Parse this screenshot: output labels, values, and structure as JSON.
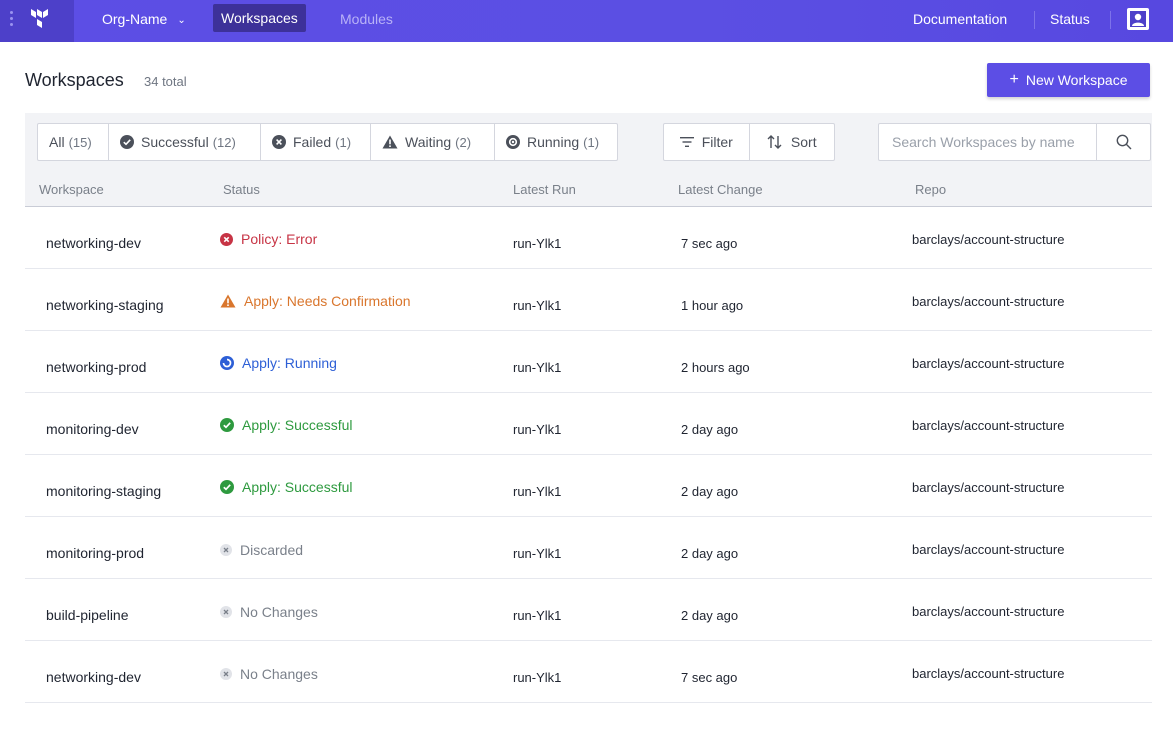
{
  "nav": {
    "org_name": "Org-Name",
    "items": [
      {
        "label": "Workspaces"
      },
      {
        "label": "Modules"
      }
    ],
    "documentation": "Documentation",
    "status": "Status",
    "brand_color": "#5c4ee5"
  },
  "header": {
    "title": "Workspaces",
    "count": "34 total",
    "new_button": "New Workspace"
  },
  "filters": {
    "tabs": [
      {
        "label": "All",
        "count": "(15)",
        "icon": ""
      },
      {
        "label": "Successful",
        "count": "(12)",
        "icon": "check-circle-icon"
      },
      {
        "label": "Failed",
        "count": "(1)",
        "icon": "x-circle-icon"
      },
      {
        "label": "Waiting",
        "count": "(2)",
        "icon": "warning-triangle-icon"
      },
      {
        "label": "Running",
        "count": "(1)",
        "icon": "running-icon"
      }
    ],
    "filter_label": "Filter",
    "sort_label": "Sort",
    "search_placeholder": "Search Workspaces by name"
  },
  "table": {
    "columns": [
      "Workspace",
      "Status",
      "Latest Run",
      "Latest Change",
      "Repo"
    ],
    "rows": [
      {
        "workspace": "networking-dev",
        "status": "Policy: Error",
        "status_kind": "error",
        "run": "run-Ylk1",
        "change": "7 sec ago",
        "repo": "barclays/account-structure"
      },
      {
        "workspace": "networking-staging",
        "status": "Apply: Needs Confirmation",
        "status_kind": "warn",
        "run": "run-Ylk1",
        "change": "1 hour ago",
        "repo": "barclays/account-structure"
      },
      {
        "workspace": "networking-prod",
        "status": "Apply: Running",
        "status_kind": "running",
        "run": "run-Ylk1",
        "change": "2 hours ago",
        "repo": "barclays/account-structure"
      },
      {
        "workspace": "monitoring-dev",
        "status": "Apply: Successful",
        "status_kind": "success",
        "run": "run-Ylk1",
        "change": "2 day ago",
        "repo": "barclays/account-structure"
      },
      {
        "workspace": "monitoring-staging",
        "status": "Apply: Successful",
        "status_kind": "success",
        "run": "run-Ylk1",
        "change": "2 day ago",
        "repo": "barclays/account-structure"
      },
      {
        "workspace": "monitoring-prod",
        "status": "Discarded",
        "status_kind": "muted",
        "run": "run-Ylk1",
        "change": "2 day ago",
        "repo": "barclays/account-structure"
      },
      {
        "workspace": "build-pipeline",
        "status": "No Changes",
        "status_kind": "muted",
        "run": "run-Ylk1",
        "change": "2 day ago",
        "repo": "barclays/account-structure"
      },
      {
        "workspace": "networking-dev",
        "status": "No Changes",
        "status_kind": "muted",
        "run": "run-Ylk1",
        "change": "7 sec ago",
        "repo": "barclays/account-structure"
      }
    ]
  },
  "colors": {
    "error": "#c73445",
    "warn": "#d9762d",
    "running": "#2d5fd6",
    "success": "#2e9a3f",
    "muted": "#7a808a"
  }
}
